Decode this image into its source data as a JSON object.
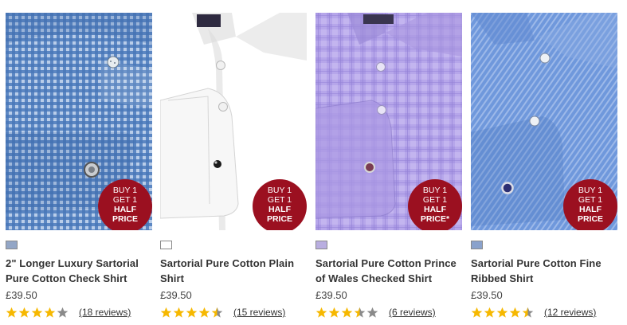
{
  "badge": {
    "line1": "BUY 1",
    "line2": "GET 1",
    "line3": "HALF",
    "line4": "PRICE",
    "line4_star": "PRICE*",
    "color": "#9b1020"
  },
  "products": [
    {
      "name_line1": "2\" Longer Luxury Sartorial",
      "name_line2": "Pure Cotton Check Shirt",
      "price": "£39.50",
      "rating": 4,
      "reviews": "(18 reviews)",
      "swatch_color": "#93a6c6",
      "shirt_color": "#5d88c9",
      "pattern": "gingham"
    },
    {
      "name_line1": "Sartorial Pure Cotton Plain",
      "name_line2": "Shirt",
      "price": "£39.50",
      "rating": 4.5,
      "reviews": "(15 reviews)",
      "swatch_color": "#ffffff",
      "shirt_color": "#ffffff",
      "pattern": "plain"
    },
    {
      "name_line1": "Sartorial Pure Cotton Prince",
      "name_line2": "of Wales Checked Shirt",
      "price": "£39.50",
      "rating": 3.5,
      "reviews": "(6 reviews)",
      "swatch_color": "#b9aee0",
      "shirt_color": "#b3a3e6",
      "pattern": "check"
    },
    {
      "name_line1": "Sartorial Pure Cotton Fine",
      "name_line2": "Ribbed Shirt",
      "price": "£39.50",
      "rating": 4.5,
      "reviews": "(12 reviews)",
      "swatch_color": "#8aa2cc",
      "shirt_color": "#6c95d8",
      "pattern": "ribbed"
    }
  ],
  "colors": {
    "star_filled": "#f6b800",
    "star_empty": "#8a8a8a"
  }
}
